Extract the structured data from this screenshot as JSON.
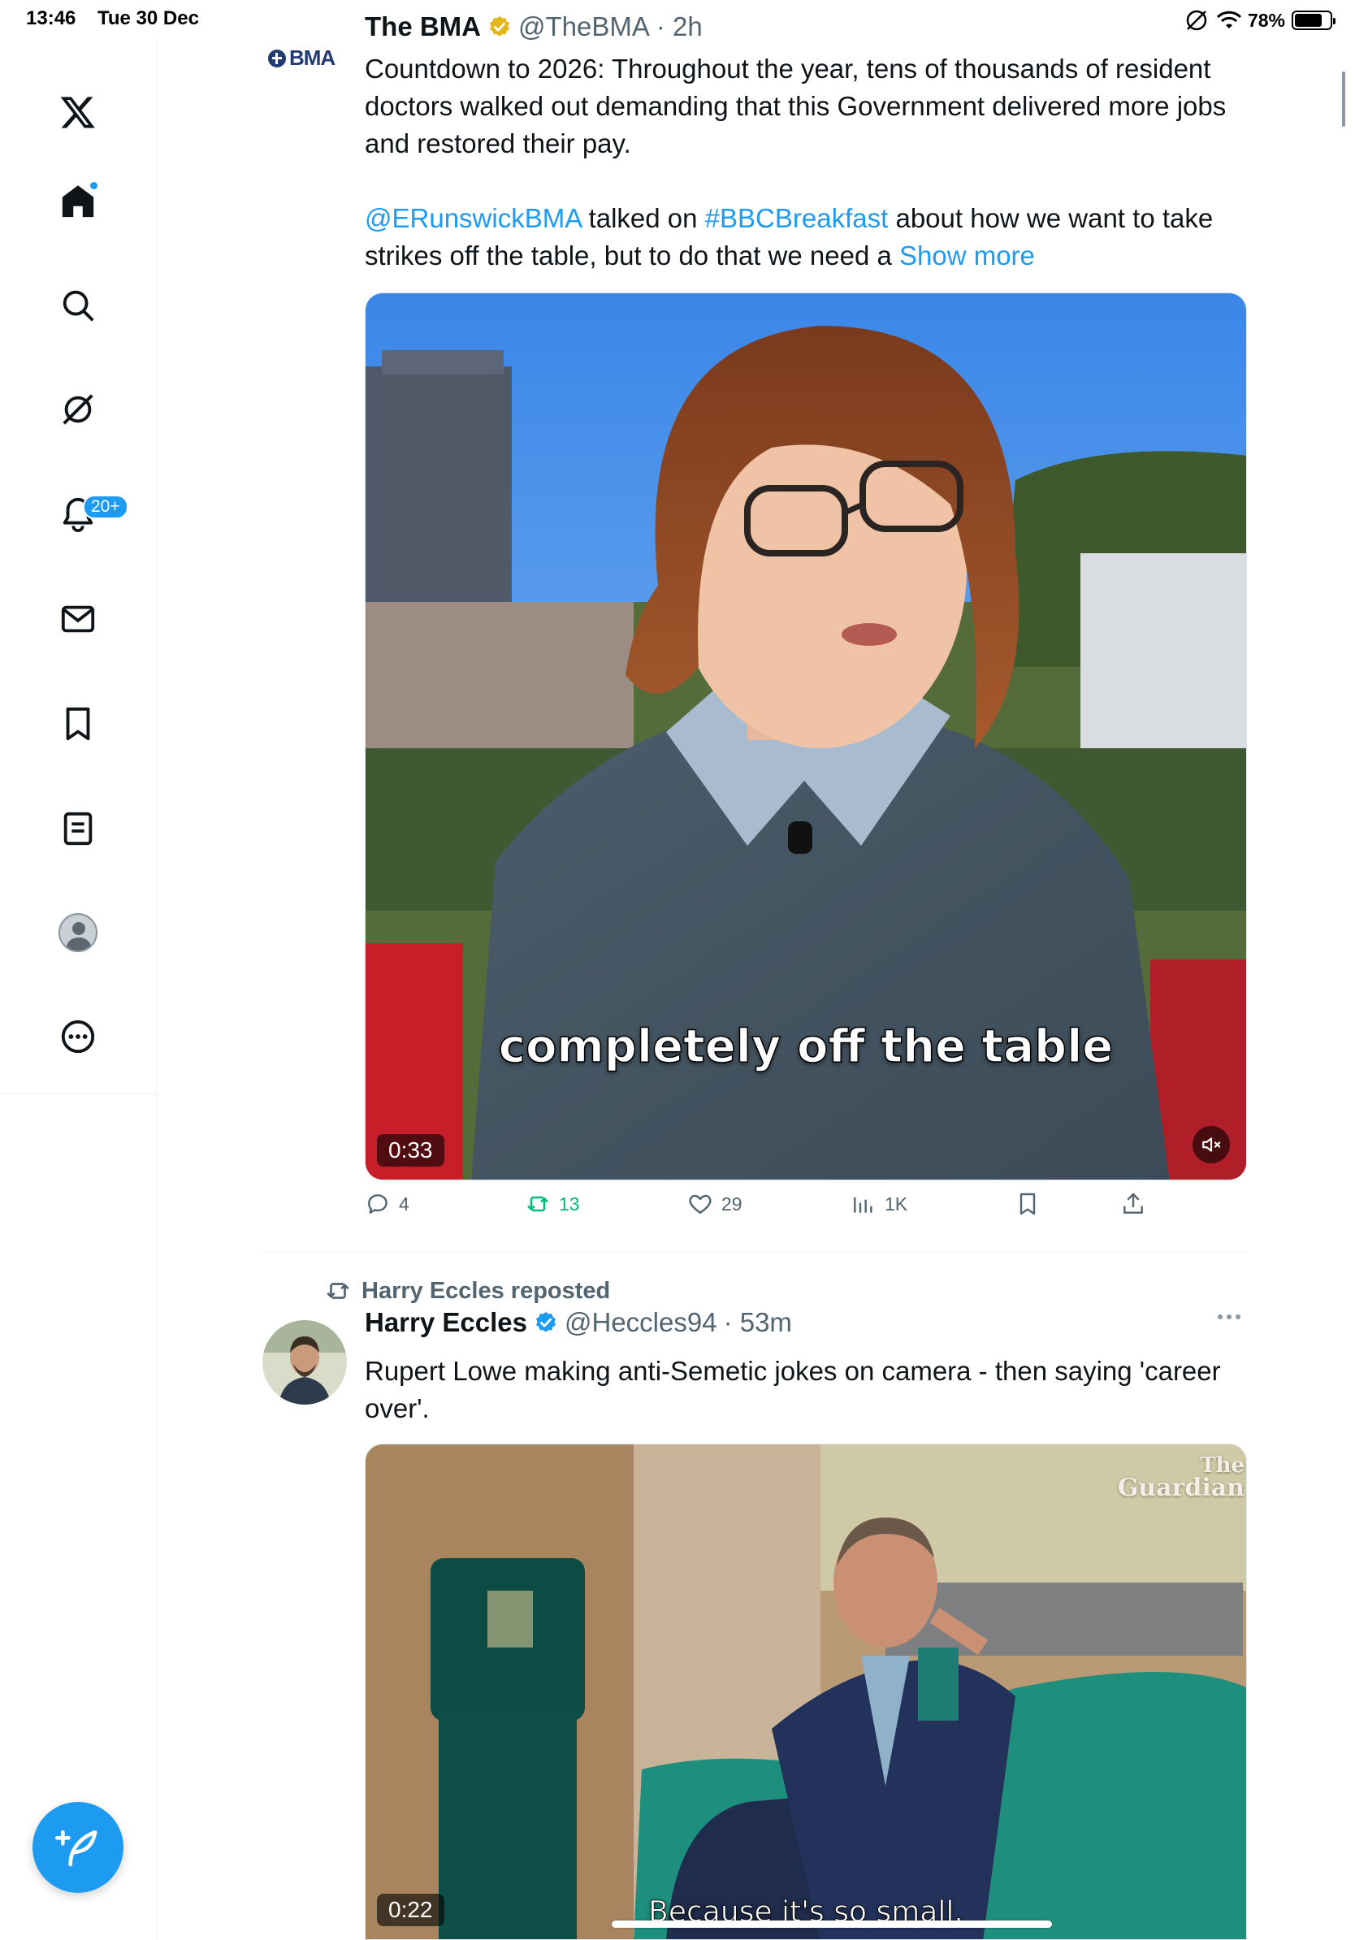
{
  "status_bar": {
    "time": "13:46",
    "date": "Tue 30 Dec",
    "battery": "78%",
    "battery_level": 0.78
  },
  "sidebar": {
    "items": [
      {
        "name": "x-logo-icon"
      },
      {
        "name": "home-icon",
        "active": true,
        "has_dot": true
      },
      {
        "name": "search-icon"
      },
      {
        "name": "grok-icon"
      },
      {
        "name": "notifications-icon",
        "badge": "20+"
      },
      {
        "name": "messages-icon"
      },
      {
        "name": "bookmarks-icon"
      },
      {
        "name": "lists-icon"
      },
      {
        "name": "profile-icon"
      },
      {
        "name": "more-icon"
      }
    ],
    "compose_icon": "compose-post-icon"
  },
  "tweets": [
    {
      "author": "The BMA",
      "handle": "@TheBMA",
      "time": "· 2h",
      "avatar_text": "BMA",
      "text_p1": "Countdown to 2026: Throughout the year, tens of thousands of resident doctors walked out demanding that this Government delivered more jobs and restored their pay.",
      "mention": "@ERunswickBMA",
      "text_mid1": " talked on ",
      "hashtag": "#BBCBreakfast",
      "text_mid2": " about how we want to take strikes off the table, but to do that we need a ",
      "show_more": "Show more",
      "video": {
        "duration": "0:33",
        "caption": "completely off the table"
      },
      "actions": {
        "replies": "4",
        "reposts": "13",
        "likes": "29",
        "views": "1K"
      }
    },
    {
      "reposted_by": "Harry Eccles reposted",
      "author": "Harry Eccles",
      "handle": "@Heccles94",
      "time": "· 53m",
      "text": "Rupert Lowe making anti-Semetic jokes on camera - then saying 'career over'.",
      "video": {
        "duration": "0:22",
        "caption": "Because it's so small.",
        "watermark_line1": "The",
        "watermark_line2": "Guardian"
      }
    }
  ],
  "colors": {
    "accent": "#1d9bf0",
    "repost_active": "#00ba7c",
    "muted_text": "#536471",
    "verified_gold": "#e2b719"
  }
}
